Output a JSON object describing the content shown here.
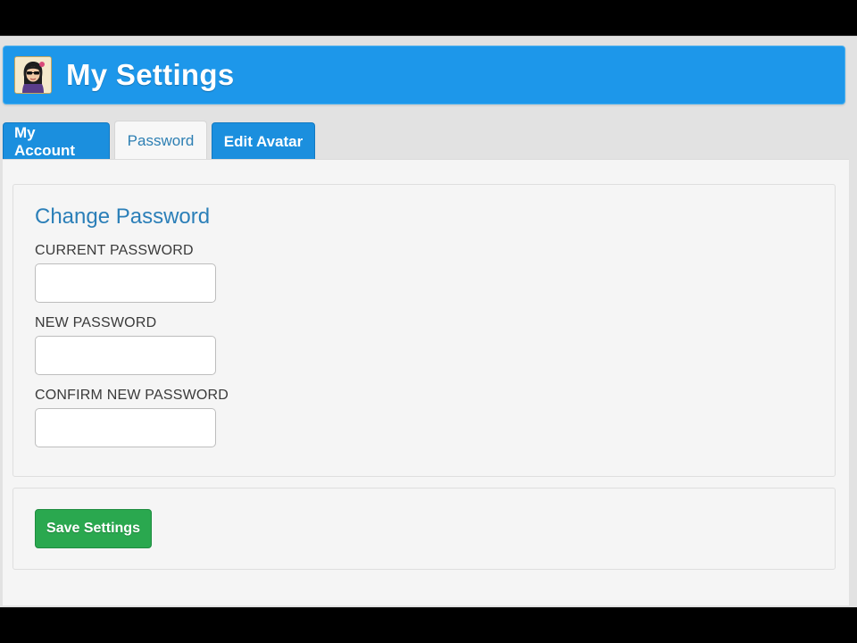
{
  "header": {
    "title": "My Settings",
    "avatar_icon": "user-avatar-icon",
    "color": "#1d97ea"
  },
  "tabs": [
    {
      "label": "My Account",
      "active": false
    },
    {
      "label": "Password",
      "active": true
    },
    {
      "label": "Edit Avatar",
      "active": false
    }
  ],
  "form": {
    "section_title": "Change Password",
    "fields": [
      {
        "label": "CURRENT PASSWORD",
        "value": "",
        "placeholder": ""
      },
      {
        "label": "NEW PASSWORD",
        "value": "",
        "placeholder": ""
      },
      {
        "label": "CONFIRM NEW PASSWORD",
        "value": "",
        "placeholder": ""
      }
    ]
  },
  "actions": {
    "save_label": "Save Settings",
    "save_color": "#2aa84f"
  }
}
